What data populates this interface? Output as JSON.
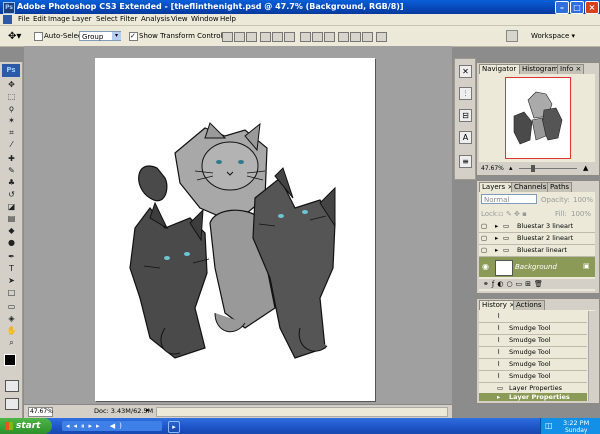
{
  "window": {
    "title": "Adobe Photoshop CS3 Extended - [theflinthenight.psd @ 47.7% (Background, RGB/8)]"
  },
  "menu": [
    "File",
    "Edit",
    "Image",
    "Layer",
    "Select",
    "Filter",
    "Analysis",
    "View",
    "Window",
    "Help"
  ],
  "options": {
    "auto_select_label": "Auto-Select:",
    "auto_select_value": "Group",
    "show_transform_label": "Show Transform Controls",
    "workspace_label": "Workspace"
  },
  "status": {
    "zoom": "47.67%",
    "doc": "Doc: 3.43M/62.5M"
  },
  "navigator": {
    "tabs": [
      "Navigator",
      "Histogram",
      "Info"
    ],
    "zoom": "47.67%"
  },
  "layers": {
    "tabs": [
      "Layers",
      "Channels",
      "Paths"
    ],
    "blend_mode": "Normal",
    "opacity_label": "Opacity:",
    "opacity": "100%",
    "lock_label": "Lock:",
    "fill_label": "Fill:",
    "fill": "100%",
    "items": [
      {
        "name": "Bluestar 3 lineart"
      },
      {
        "name": "Bluestar 2 lineart"
      },
      {
        "name": "Bluestar lineart"
      },
      {
        "name": "Background"
      }
    ]
  },
  "history": {
    "tabs": [
      "History",
      "Actions"
    ],
    "items": [
      {
        "name": ""
      },
      {
        "name": "Smudge Tool"
      },
      {
        "name": "Smudge Tool"
      },
      {
        "name": "Smudge Tool"
      },
      {
        "name": "Smudge Tool"
      },
      {
        "name": "Smudge Tool"
      },
      {
        "name": "Layer Properties"
      },
      {
        "name": "Layer Properties"
      }
    ]
  },
  "taskbar": {
    "start_label": "start",
    "time": "3:22 PM",
    "day": "Sunday"
  },
  "colors": {
    "titlebar": "#0647b8",
    "selected_layer": "#8b9a57",
    "canvas_bg": "#ffffff",
    "cat_dark": "#4a4a4a",
    "cat_mid": "#8a8a8a",
    "cat_light": "#a8a8a8"
  }
}
